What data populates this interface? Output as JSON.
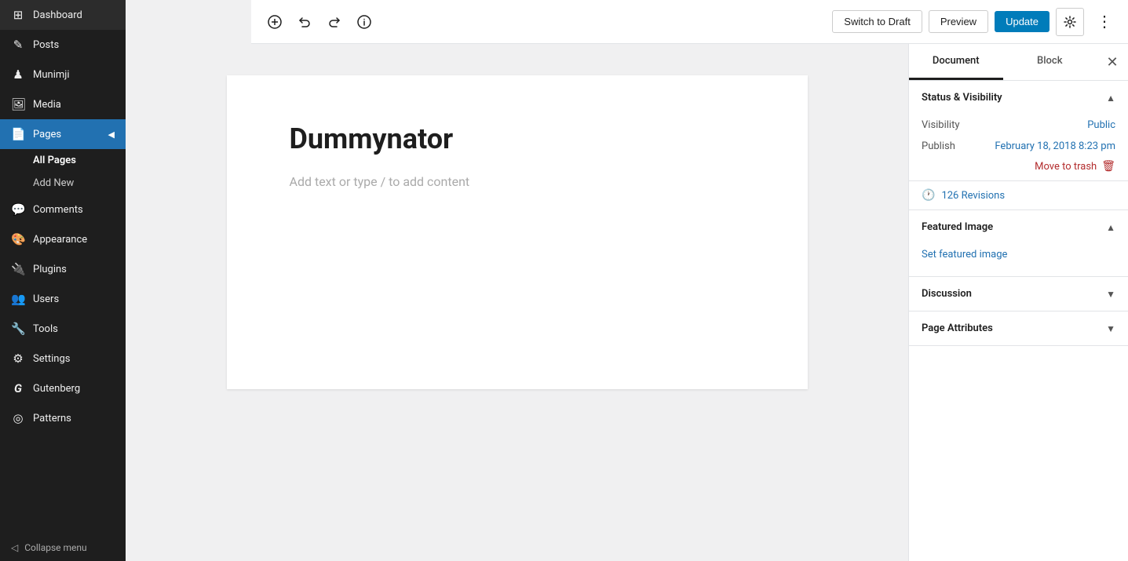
{
  "sidebar": {
    "items": [
      {
        "id": "dashboard",
        "label": "Dashboard",
        "icon": "⊞"
      },
      {
        "id": "posts",
        "label": "Posts",
        "icon": "📝"
      },
      {
        "id": "munimji",
        "label": "Munimji",
        "icon": "👤"
      },
      {
        "id": "media",
        "label": "Media",
        "icon": "🖼"
      },
      {
        "id": "pages",
        "label": "Pages",
        "icon": "📄"
      },
      {
        "id": "comments",
        "label": "Comments",
        "icon": "💬"
      },
      {
        "id": "appearance",
        "label": "Appearance",
        "icon": "🎨"
      },
      {
        "id": "plugins",
        "label": "Plugins",
        "icon": "🔌"
      },
      {
        "id": "users",
        "label": "Users",
        "icon": "👥"
      },
      {
        "id": "tools",
        "label": "Tools",
        "icon": "🔧"
      },
      {
        "id": "settings",
        "label": "Settings",
        "icon": "⚙"
      },
      {
        "id": "gutenberg",
        "label": "Gutenberg",
        "icon": "G"
      },
      {
        "id": "patterns",
        "label": "Patterns",
        "icon": "◎"
      }
    ],
    "pages_sub": [
      {
        "id": "all-pages",
        "label": "All Pages",
        "active": true
      },
      {
        "id": "add-new",
        "label": "Add New",
        "active": false
      }
    ],
    "collapse_label": "Collapse menu"
  },
  "toolbar": {
    "switch_to_draft": "Switch to Draft",
    "preview": "Preview",
    "update": "Update",
    "settings_label": "Settings",
    "more_label": "More options"
  },
  "editor": {
    "page_title": "Dummynator",
    "body_placeholder": "Add text or type / to add content"
  },
  "right_panel": {
    "tabs": [
      {
        "id": "document",
        "label": "Document",
        "active": true
      },
      {
        "id": "block",
        "label": "Block",
        "active": false
      }
    ],
    "close_label": "Close",
    "status_visibility": {
      "title": "Status & Visibility",
      "visibility_label": "Visibility",
      "visibility_value": "Public",
      "publish_label": "Publish",
      "publish_value": "February 18, 2018 8:23 pm",
      "trash_label": "Move to trash"
    },
    "revisions": {
      "count": "126 Revisions"
    },
    "featured_image": {
      "title": "Featured Image",
      "set_link": "Set featured image"
    },
    "discussion": {
      "title": "Discussion"
    },
    "page_attributes": {
      "title": "Page Attributes"
    }
  }
}
